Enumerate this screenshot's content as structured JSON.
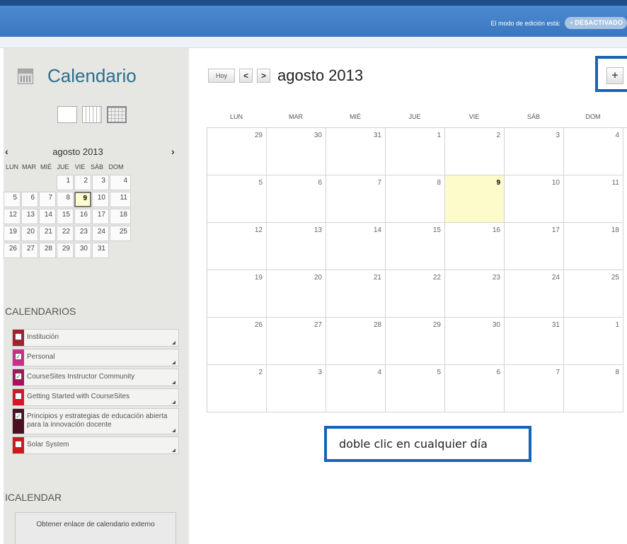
{
  "topbar": {
    "edit_mode_label": "El modo de edición está:",
    "edit_mode_state": "• DESACTIVADO"
  },
  "sidebar": {
    "title": "Calendario",
    "views": [
      "day",
      "week",
      "month"
    ],
    "mini": {
      "month_title": "agosto 2013",
      "prev": "‹",
      "next": "›",
      "weekdays": [
        "LUN",
        "MAR",
        "MIÉ",
        "JUE",
        "VIE",
        "SÁB",
        "DOM"
      ],
      "weeks": [
        [
          "",
          "",
          "",
          "1",
          "2",
          "3",
          "4"
        ],
        [
          "5",
          "6",
          "7",
          "8",
          "9",
          "10",
          "11"
        ],
        [
          "12",
          "13",
          "14",
          "15",
          "16",
          "17",
          "18"
        ],
        [
          "19",
          "20",
          "21",
          "22",
          "23",
          "24",
          "25"
        ],
        [
          "26",
          "27",
          "28",
          "29",
          "30",
          "31",
          ""
        ]
      ],
      "today": "9"
    },
    "calendars_title": "CALENDARIOS",
    "calendars": [
      {
        "label": "Institución",
        "color": "#a4202b",
        "checked": false
      },
      {
        "label": "Personal",
        "color": "#c92f8c",
        "checked": true
      },
      {
        "label": "CourseSites Instructor Community",
        "color": "#a3145c",
        "checked": true
      },
      {
        "label": "Getting Started with CourseSites",
        "color": "#d81726",
        "checked": false
      },
      {
        "label": "Principios y estrategias de educación abierta para la innovación docente",
        "color": "#4c0f22",
        "checked": true
      },
      {
        "label": "Solar System",
        "color": "#cc1a1a",
        "checked": false
      }
    ],
    "ical_title": "ICALENDAR",
    "ical_button": "Obtener enlace de calendario externo"
  },
  "main": {
    "today_button": "Hoy",
    "prev": "<",
    "next": ">",
    "month_title": "agosto 2013",
    "add_button": "+",
    "weekdays": [
      "LUN",
      "MAR",
      "MIÉ",
      "JUE",
      "VIE",
      "SÁB",
      "DOM"
    ],
    "weeks": [
      [
        "29",
        "30",
        "31",
        "1",
        "2",
        "3",
        "4"
      ],
      [
        "5",
        "6",
        "7",
        "8",
        "9",
        "10",
        "11"
      ],
      [
        "12",
        "13",
        "14",
        "15",
        "16",
        "17",
        "18"
      ],
      [
        "19",
        "20",
        "21",
        "22",
        "23",
        "24",
        "25"
      ],
      [
        "26",
        "27",
        "28",
        "29",
        "30",
        "31",
        "1"
      ],
      [
        "2",
        "3",
        "4",
        "5",
        "6",
        "7",
        "8"
      ]
    ],
    "today": "9"
  },
  "callout": {
    "text": "doble clic en cualquier día"
  },
  "colors": {
    "accent": "#1763b8",
    "title": "#2a6f8f",
    "today_bg": "#fdfbc9",
    "topbar": "#3b76bf"
  }
}
